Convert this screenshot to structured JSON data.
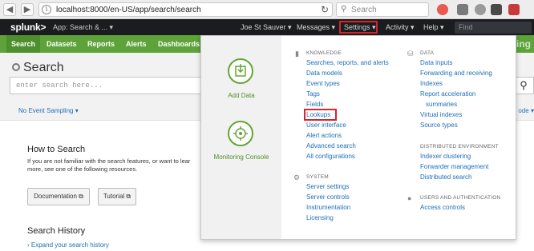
{
  "browser": {
    "url": "localhost:8000/en-US/app/search/search",
    "search_placeholder": "Search"
  },
  "topbar": {
    "logo": "splunk>",
    "app_menu": "App: Search & ... ▾",
    "user": "Joe St Sauver ▾",
    "messages": "Messages ▾",
    "settings": "Settings ▾",
    "activity": "Activity ▾",
    "help": "Help ▾",
    "find_placeholder": "Find"
  },
  "appbar": {
    "tabs": [
      "Search",
      "Datasets",
      "Reports",
      "Alerts",
      "Dashboards"
    ],
    "right_text": "rting"
  },
  "search": {
    "title": "Search",
    "placeholder": "enter search here...",
    "sampling": "No Event Sampling ▾",
    "mode": "ode ▾",
    "how_title": "How to Search",
    "how_text": "If you are not familiar with the search features, or want to lear more, see one of the following resources.",
    "documentation_btn": "Documentation ⧉",
    "tutorial_btn": "Tutorial ⧉",
    "history_title": "Search History",
    "history_link": "Expand your search history"
  },
  "dropdown": {
    "add_data": "Add Data",
    "monitoring_console": "Monitoring Console",
    "knowledge": {
      "title": "KNOWLEDGE",
      "links": [
        "Searches, reports, and alerts",
        "Data models",
        "Event types",
        "Tags",
        "Fields",
        "Lookups",
        "User interface",
        "Alert actions",
        "Advanced search",
        "All configurations"
      ]
    },
    "system": {
      "title": "SYSTEM",
      "links": [
        "Server settings",
        "Server controls",
        "Instrumentation",
        "Licensing"
      ]
    },
    "data": {
      "title": "DATA",
      "links": [
        "Data inputs",
        "Forwarding and receiving",
        "Indexes",
        "Report acceleration",
        "summaries",
        "Virtual indexes",
        "Source types"
      ]
    },
    "distributed": {
      "title": "DISTRIBUTED ENVIRONMENT",
      "links": [
        "Indexer clustering",
        "Forwarder management",
        "Distributed search"
      ]
    },
    "users": {
      "title": "USERS AND AUTHENTICATION",
      "links": [
        "Access controls"
      ]
    }
  },
  "colors": {
    "splunk_green": "#5ea33a",
    "topbar": "#1a1c1f",
    "link_blue": "#1e6fba",
    "highlight_red": "#d8242b"
  }
}
